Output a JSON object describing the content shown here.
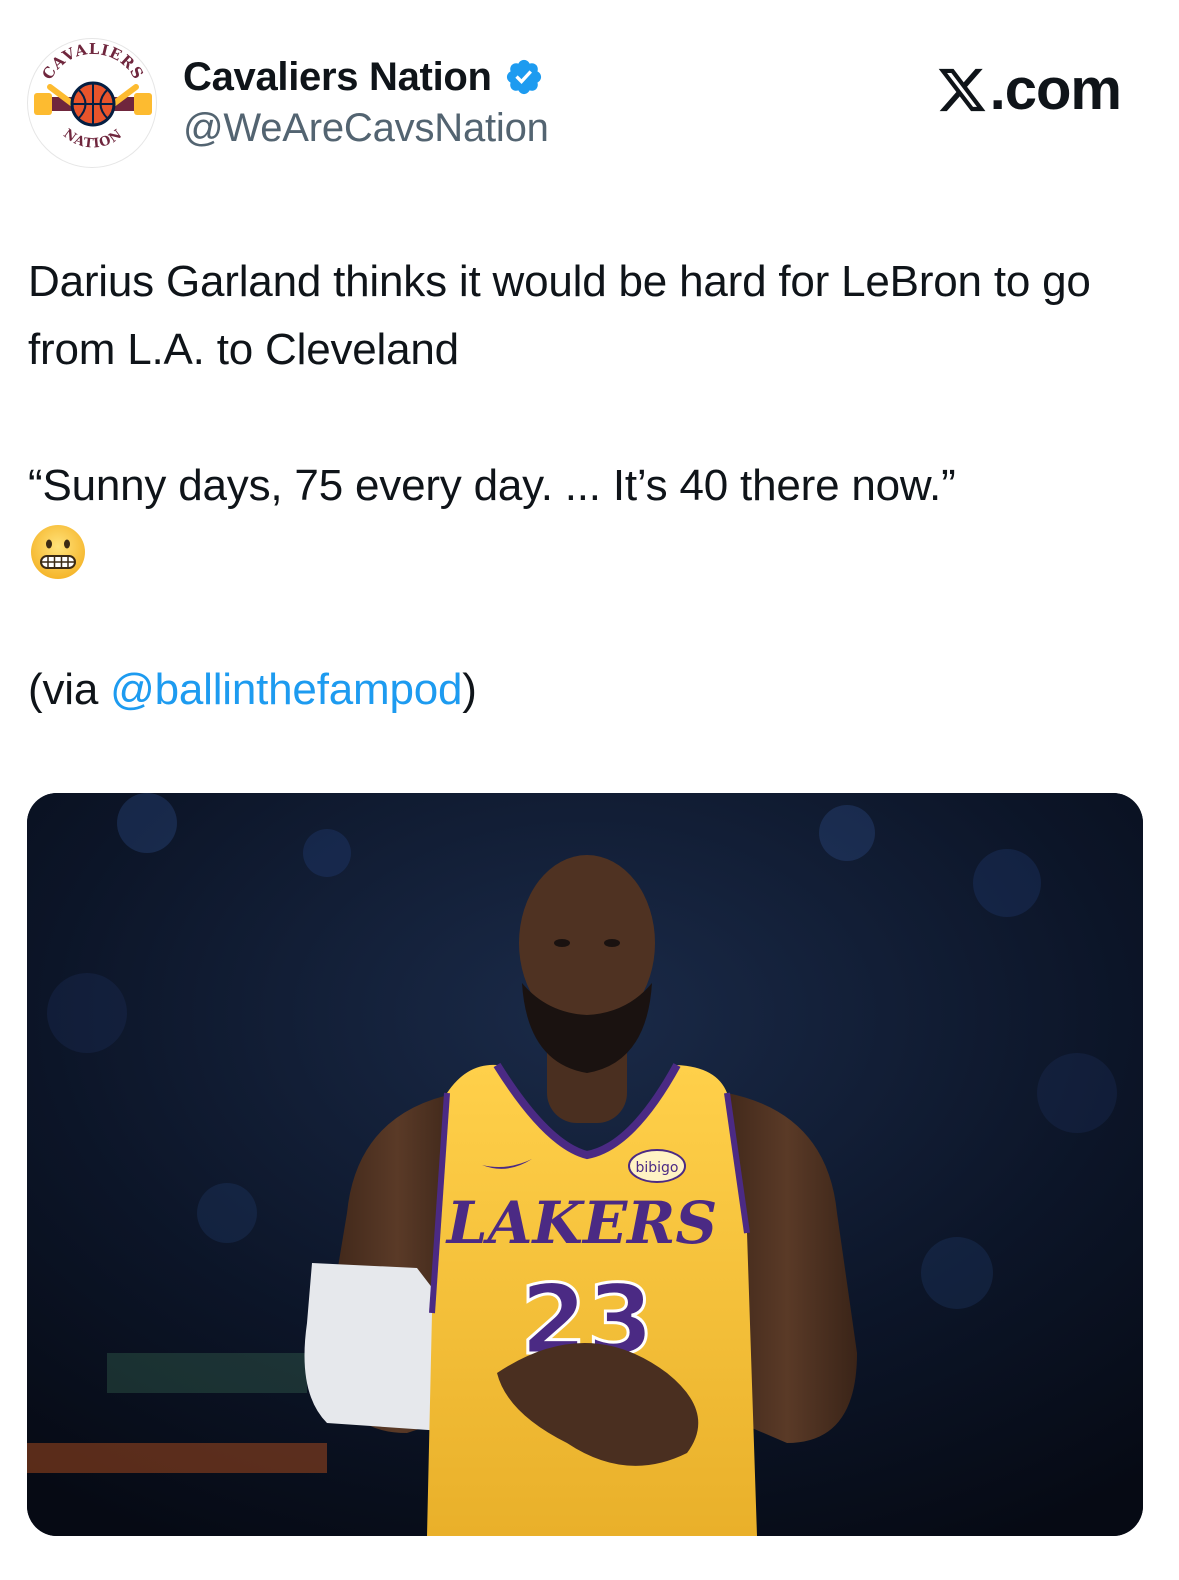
{
  "author": {
    "display_name": "Cavaliers Nation",
    "handle": "@WeAreCavsNation",
    "verified": true,
    "avatar": {
      "icon": "cavaliers-nation-logo",
      "text_top": "CAVALIERS",
      "text_bottom": "NATION"
    }
  },
  "site": {
    "brand_suffix": ".com",
    "icon": "x-logo-icon"
  },
  "tweet": {
    "line1": "Darius Garland thinks it would be hard for LeBron to go from L.A. to Cleveland",
    "quote": "“Sunny days, 75 every day. ... It’s 40 there now.”",
    "emoji": "grimacing-face",
    "via_prefix": "(via ",
    "via_mention": "@ballinthefampod",
    "via_suffix": ")"
  },
  "media": {
    "description_icon": "basketball-player-photo",
    "jersey_team": "LAKERS",
    "jersey_number": "23",
    "jersey_sponsor": "bibigo",
    "colors": {
      "jersey": "#f5c23a",
      "trim": "#4b2a84",
      "background": "#0b1426"
    }
  },
  "colors": {
    "link": "#1d9bf0",
    "verified": "#1d9bf0",
    "muted": "#536471",
    "text": "#0f1419"
  }
}
